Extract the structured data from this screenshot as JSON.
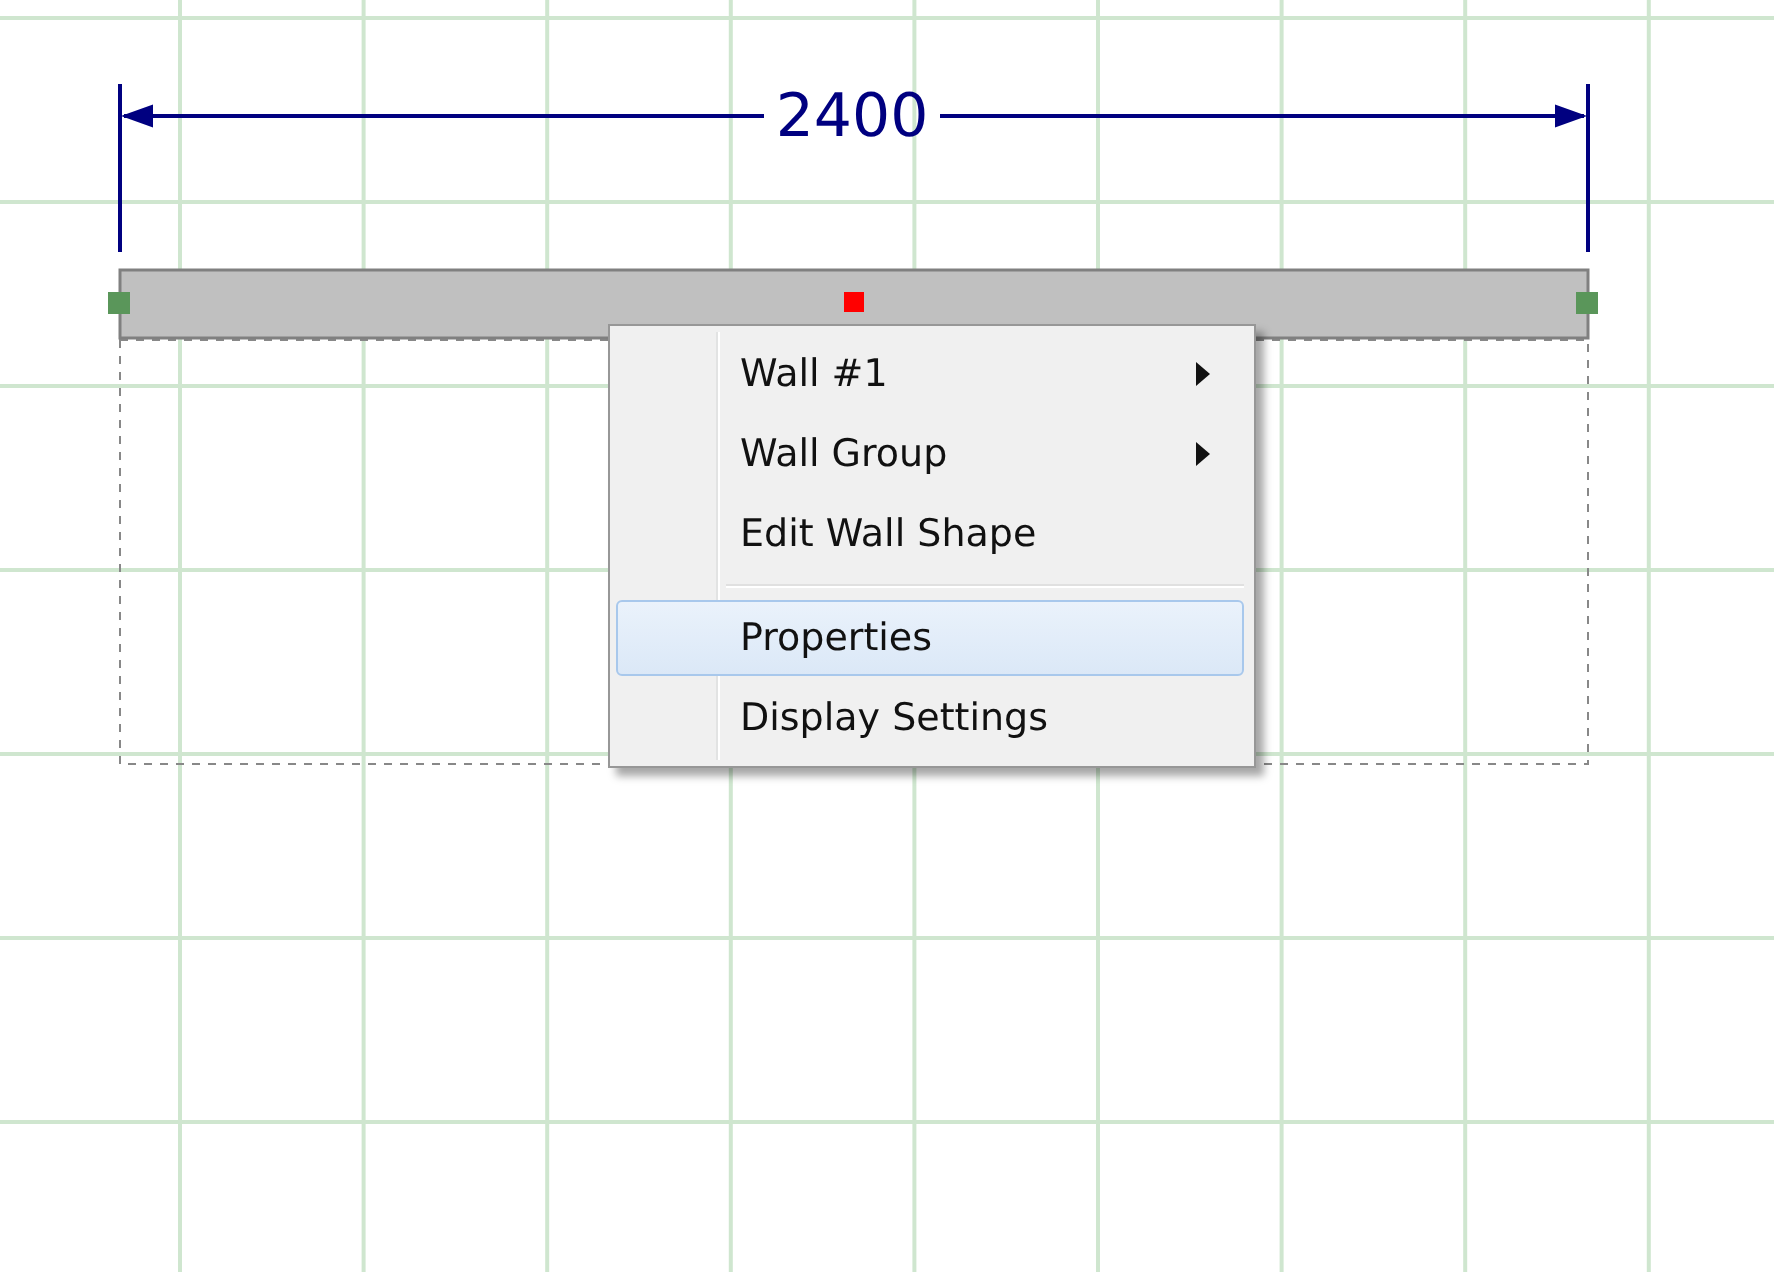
{
  "dimension": {
    "label": "2400"
  },
  "wall": {
    "selected": true
  },
  "context_menu": {
    "items": [
      {
        "kind": "item",
        "label": "Wall #1",
        "submenu": true,
        "selected": false
      },
      {
        "kind": "item",
        "label": "Wall Group",
        "submenu": true,
        "selected": false
      },
      {
        "kind": "item",
        "label": "Edit Wall Shape",
        "submenu": false,
        "selected": false
      },
      {
        "kind": "separator"
      },
      {
        "kind": "item",
        "label": "Properties",
        "submenu": false,
        "selected": true
      },
      {
        "kind": "item",
        "label": "Display Settings",
        "submenu": false,
        "selected": false
      }
    ]
  }
}
